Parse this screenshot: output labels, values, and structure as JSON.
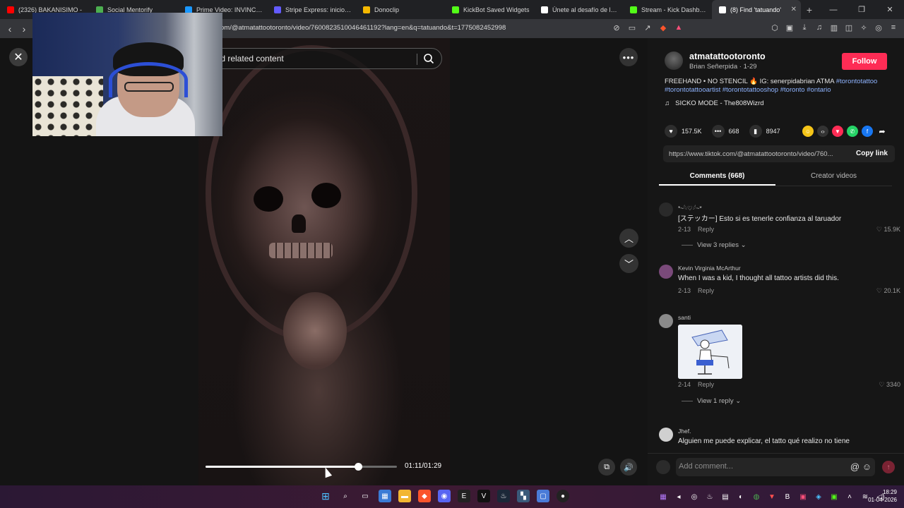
{
  "browser": {
    "tabs": [
      {
        "title": "(2326) BAKANISIMO -",
        "color": "#ff0000",
        "active": false
      },
      {
        "title": "Social Mentorify",
        "color": "#4caf50",
        "active": false
      },
      {
        "title": "Prime Video: INVINCIBLE",
        "color": "#1a98ff",
        "active": false
      },
      {
        "title": "Stripe Express: inicio de se",
        "color": "#635bff",
        "active": false
      },
      {
        "title": "Donoclip",
        "color": "#f5b800",
        "active": false
      },
      {
        "title": "KickBot Saved Widgets",
        "color": "#53fc18",
        "active": false
      },
      {
        "title": "Únete al desafío de la tabl",
        "color": "#ffffff",
        "active": false
      },
      {
        "title": "Stream - Kick Dashboard",
        "color": "#53fc18",
        "active": false
      },
      {
        "title": "(8) Find 'tatuando'",
        "color": "#ffffff",
        "active": true
      }
    ],
    "url": "om/@atmatattootoronto/video/7600823510046461192?lang=en&q=tatuando&t=1775082452998"
  },
  "player": {
    "search_placeholder": "ind related content",
    "time": "01:11/01:29",
    "progress_fraction": 0.797
  },
  "panel": {
    "username": "atmatattootoronto",
    "subtitle": "Brian Señerpida · 1-29",
    "follow_label": "Follow",
    "description_prefix": "FREEHAND • NO STENCIL 🔥 IG: senerpidabrian ATMA ",
    "hashtags": [
      "#torontotattoo",
      "#torontotattooartist",
      "#torontotattooshop",
      "#toronto",
      "#ontario"
    ],
    "music": "SICKO MODE - The808Wizrd",
    "likes": "157.5K",
    "comments_count": "668",
    "saves": "8947",
    "link": "https://www.tiktok.com/@atmatattootoronto/video/760...",
    "copy_label": "Copy link",
    "tab_comments": "Comments (668)",
    "tab_creator": "Creator videos"
  },
  "comments": [
    {
      "name": "*~𓆩♡𓆪~*",
      "text": "[ステッカー] Esto si es tenerle confianza al taruador",
      "date": "2-13",
      "reply": "Reply",
      "likes": "15.9K",
      "replies": "View 3 replies ⌄"
    },
    {
      "name": "Kevin Virginia McArthur",
      "text": "When I was a kid, I thought all tattoo artists did this.",
      "date": "2-13",
      "reply": "Reply",
      "likes": "20.1K",
      "replies": ""
    },
    {
      "name": "santi",
      "text": "",
      "date": "2-14",
      "reply": "Reply",
      "likes": "3340",
      "replies": "View 1 reply ⌄"
    },
    {
      "name": "Jhef.",
      "text": "Alguien me puede explicar, el tatto qué realizo no tiene",
      "date": "",
      "reply": "",
      "likes": "",
      "replies": ""
    }
  ],
  "add_comment_placeholder": "Add comment...",
  "taskbar": {
    "time": "18:29",
    "date": "01-04-2026"
  }
}
